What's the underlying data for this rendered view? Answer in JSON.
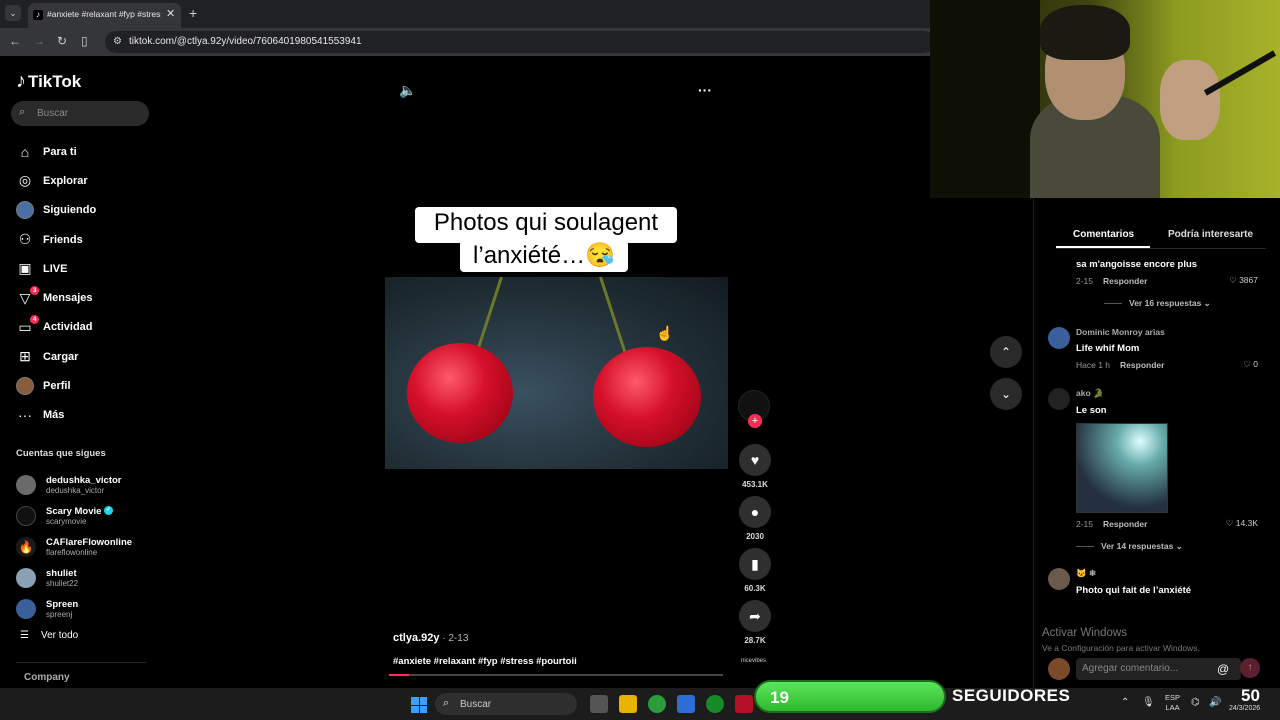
{
  "browser": {
    "tab_title": "#anxiete #relaxant #fyp #stress",
    "url": "tiktok.com/@ctlya.92y/video/7606401980541553941"
  },
  "sidebar": {
    "logo": "TikTok",
    "search_placeholder": "Buscar",
    "nav": [
      {
        "label": "Para ti",
        "icon": "home-icon",
        "badge": ""
      },
      {
        "label": "Explorar",
        "icon": "compass-icon",
        "badge": ""
      },
      {
        "label": "Siguiendo",
        "icon": "avatar",
        "badge": ""
      },
      {
        "label": "Friends",
        "icon": "friends-icon",
        "badge": ""
      },
      {
        "label": "LIVE",
        "icon": "live-icon",
        "badge": ""
      },
      {
        "label": "Mensajes",
        "icon": "messages-icon",
        "badge": "3"
      },
      {
        "label": "Actividad",
        "icon": "activity-icon",
        "badge": "4"
      },
      {
        "label": "Cargar",
        "icon": "upload-icon",
        "badge": ""
      },
      {
        "label": "Perfil",
        "icon": "avatar",
        "badge": ""
      },
      {
        "label": "Más",
        "icon": "more-icon",
        "badge": ""
      }
    ],
    "following_title": "Cuentas que sigues",
    "following": [
      {
        "name": "dedushka_victor",
        "user": "dedushka_victor",
        "verified": false
      },
      {
        "name": "Scary Movie",
        "user": "scarymovie",
        "verified": true
      },
      {
        "name": "CAFlareFlowonline",
        "user": "flareflowonline",
        "verified": false
      },
      {
        "name": "shuliet",
        "user": "shuliet22",
        "verified": false
      },
      {
        "name": "Spreen",
        "user": "spreenɉ",
        "verified": false
      }
    ],
    "see_all": "Ver todo",
    "company": "Company"
  },
  "video": {
    "caption_line1": "Photos qui soulagent",
    "caption_line2": "l’anxiété…😪",
    "author": "ctlya.92y",
    "date": "2-13",
    "hashtags": "#anxiete #relaxant #fyp #stress #pourtoii",
    "progress": 0.06,
    "music": "nicevibes"
  },
  "actions": {
    "likes": "453.1K",
    "comments": "2030",
    "saves": "60.3K",
    "shares": "28.7K"
  },
  "comments_panel": {
    "tab_comments": "Comentarios",
    "tab_other": "Podría interesarte",
    "top_comment_text": "sa m'angoisse encore plus",
    "top_comment_date": "2-15",
    "top_comment_likes": "3867",
    "reply_label": "Responder",
    "top_more": "Ver 16 respuestas",
    "c1_user": "Dominic Monroy arias",
    "c1_text": "Life whif Mom",
    "c1_date": "Hace 1 h",
    "c1_likes": "0",
    "c2_user": "ako 🐊",
    "c2_text": "Le son",
    "c2_date": "2-15",
    "c2_likes": "14.3K",
    "c2_more": "Ver 14 respuestas",
    "c3_user": "🐱 ❄",
    "c3_text": "Photo qui fait de l’anxiété",
    "add_placeholder": "Agregar comentario...",
    "watermark_title": "Activar Windows",
    "watermark_sub": "Ve a Configuración para activar Windows."
  },
  "taskbar": {
    "search_label": "Buscar",
    "lang_line1": "ESP",
    "lang_line2": "LAA",
    "date": "24/3/2026"
  },
  "overlay": {
    "followers_count": "19",
    "followers_label": "SEGUIDORES",
    "goal": "50"
  },
  "colors": {
    "accent": "#fe2c55",
    "follower_green": "#3ccf3c"
  }
}
